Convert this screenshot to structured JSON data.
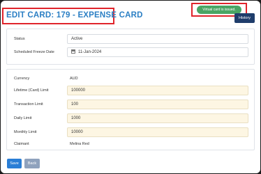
{
  "header": {
    "title": "EDIT CARD: 179 - EXPENSE CARD",
    "history_label": "History"
  },
  "toast": {
    "message": "Virtual card is issued."
  },
  "settings": {
    "status_label": "Status",
    "status_value": "Active",
    "freeze_label": "Scheduled Freeze Date",
    "freeze_value": "11-Jan-2024"
  },
  "limits": {
    "currency_label": "Currency",
    "currency_value": "AUD",
    "lifetime_label": "Lifetime (Card) Limit",
    "lifetime_value": "100000",
    "transaction_label": "Transaction Limit",
    "transaction_value": "100",
    "daily_label": "Daily Limit",
    "daily_value": "1000",
    "monthly_label": "Monthly Limit",
    "monthly_value": "10000",
    "claimant_label": "Claimant",
    "claimant_value": "Melina Red"
  },
  "actions": {
    "save_label": "Save",
    "back_label": "Back"
  },
  "icons": {
    "freeze_date": "calendar-icon"
  },
  "colors": {
    "title": "#2b7fc4",
    "toast": "#4aa564",
    "history_button": "#1f3d6b",
    "save_button": "#2a7ed6",
    "back_button": "#8fa2bd",
    "highlight_box": "#e0242b",
    "limit_field_bg": "#fdf6e3"
  }
}
